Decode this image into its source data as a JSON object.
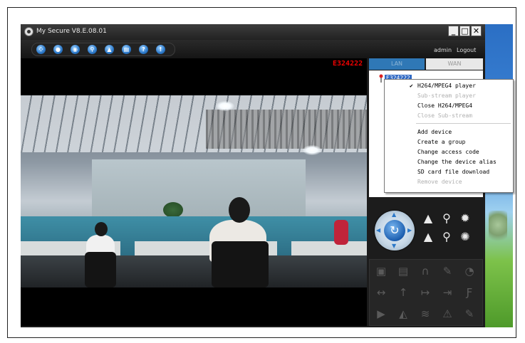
{
  "window": {
    "title": "My Secure  V8.E.08.01",
    "minimize": "_",
    "maximize": "□",
    "close": "✕"
  },
  "toolbar": {
    "icons": [
      "grid-icon",
      "record-icon",
      "snapshot-icon",
      "search-icon",
      "lock-icon",
      "playback-icon",
      "help-icon",
      "info-icon"
    ],
    "glyphs": [
      "⁘",
      "●",
      "◉",
      "⚲",
      "▲",
      "▤",
      "?",
      "!"
    ],
    "user": "admin",
    "logout": "Logout"
  },
  "video": {
    "device_label": "E324222"
  },
  "side": {
    "tabs": [
      {
        "label": "LAN"
      },
      {
        "label": "WAN"
      }
    ],
    "tree_node": "E324222"
  },
  "context_menu": {
    "items": [
      {
        "label": "H264/MPEG4 player",
        "enabled": true,
        "checked": true
      },
      {
        "label": "Sub-stream player",
        "enabled": false
      },
      {
        "label": "Close H264/MPEG4",
        "enabled": true
      },
      {
        "label": "Close Sub-stream",
        "enabled": false
      },
      {
        "label": "Add device",
        "enabled": true
      },
      {
        "label": "Create a group",
        "enabled": true
      },
      {
        "label": "Change access code",
        "enabled": true
      },
      {
        "label": "Change the device alias",
        "enabled": true
      },
      {
        "label": "SD card file download",
        "enabled": true
      },
      {
        "label": "Remove device",
        "enabled": false
      }
    ],
    "check_glyph": "✔"
  },
  "ptz": {
    "center_glyph": "↻",
    "buttons": [
      {
        "name": "tilt-up-icon",
        "glyph": "▲"
      },
      {
        "name": "zoom-in-icon",
        "glyph": "⚲"
      },
      {
        "name": "focus-near-icon",
        "glyph": "✹"
      },
      {
        "name": "tilt-down-icon",
        "glyph": "▲"
      },
      {
        "name": "zoom-out-icon",
        "glyph": "⚲"
      },
      {
        "name": "focus-far-icon",
        "glyph": "✺"
      }
    ]
  },
  "function_grid": [
    {
      "name": "camera-icon",
      "glyph": "▣"
    },
    {
      "name": "folder-icon",
      "glyph": "▤"
    },
    {
      "name": "headphones-icon",
      "glyph": "∩"
    },
    {
      "name": "brush-icon",
      "glyph": "✎"
    },
    {
      "name": "clock-icon",
      "glyph": "◔"
    },
    {
      "name": "swap-horizontal-icon",
      "glyph": "↔"
    },
    {
      "name": "arrow-up-icon",
      "glyph": "↑"
    },
    {
      "name": "arrow-right-icon",
      "glyph": "↦"
    },
    {
      "name": "export-icon",
      "glyph": "⇥"
    },
    {
      "name": "flag-icon",
      "glyph": "Ƒ"
    },
    {
      "name": "play-icon",
      "glyph": "▶"
    },
    {
      "name": "brightness-icon",
      "glyph": "◭"
    },
    {
      "name": "wifi-icon",
      "glyph": "≋"
    },
    {
      "name": "alarm-icon",
      "glyph": "⚠"
    },
    {
      "name": "settings-wrench-icon",
      "glyph": "✎"
    }
  ]
}
